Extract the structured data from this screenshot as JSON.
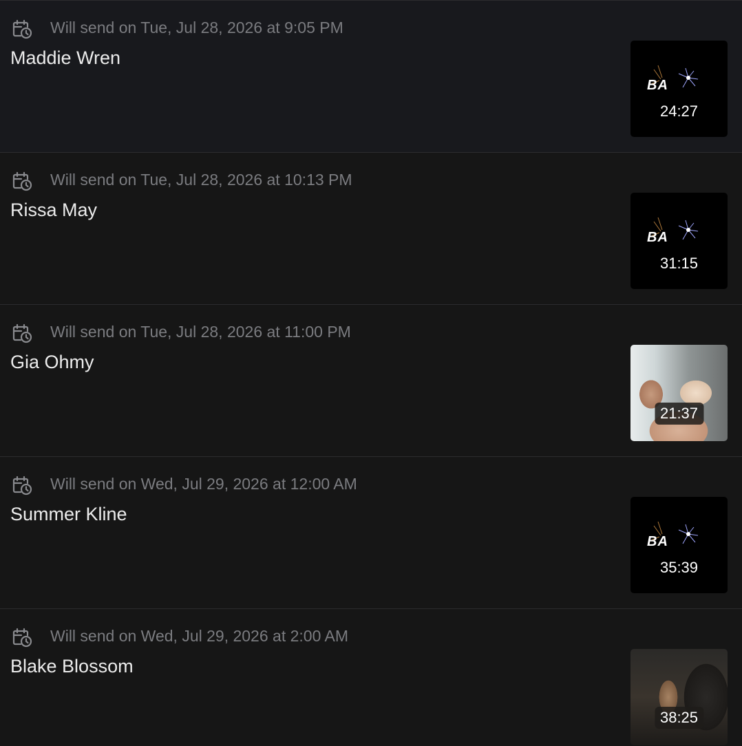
{
  "items": [
    {
      "schedule": "Will send on Tue, Jul 28, 2026 at 9:05 PM",
      "name": "Maddie Wren",
      "duration": "24:27",
      "thumb_logo": "BA",
      "thumb_style": "logo"
    },
    {
      "schedule": "Will send on Tue, Jul 28, 2026 at 10:13 PM",
      "name": "Rissa May",
      "duration": "31:15",
      "thumb_logo": "BA",
      "thumb_style": "logo"
    },
    {
      "schedule": "Will send on Tue, Jul 28, 2026 at 11:00 PM",
      "name": "Gia Ohmy",
      "duration": "21:37",
      "thumb_style": "photo"
    },
    {
      "schedule": "Will send on Wed, Jul 29, 2026 at 12:00 AM",
      "name": "Summer Kline",
      "duration": "35:39",
      "thumb_logo": "BA",
      "thumb_style": "logo"
    },
    {
      "schedule": "Will send on Wed, Jul 29, 2026 at 2:00 AM",
      "name": "Blake Blossom",
      "duration": "38:25",
      "thumb_style": "photo"
    }
  ],
  "icons": {
    "schedule": "calendar-clock-icon"
  },
  "colors": {
    "background": "#161616",
    "divider": "#2c2c2e",
    "schedule_text": "#7b7c80",
    "name_text": "#ececec"
  }
}
